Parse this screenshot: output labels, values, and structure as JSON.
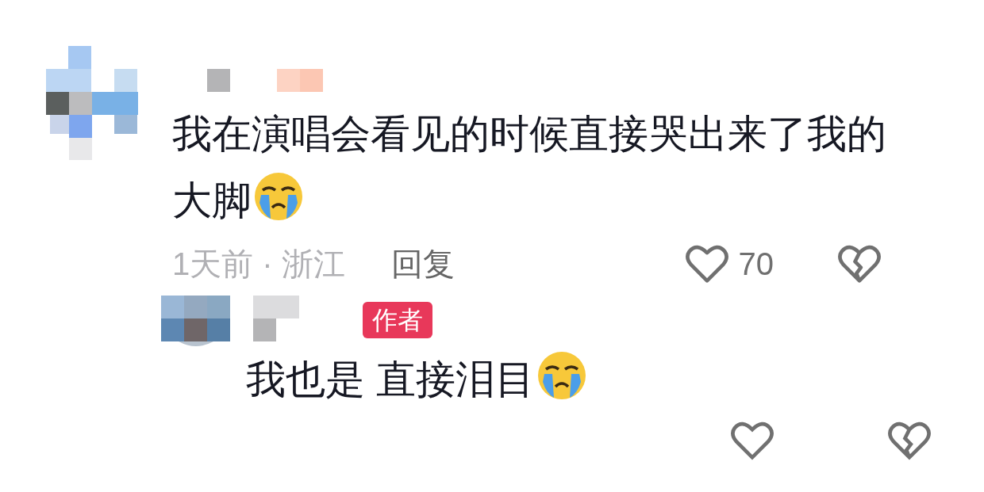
{
  "comment": {
    "text": "我在演唱会看见的时候直接哭出来了我的大脚",
    "meta": "1天前 · 浙江",
    "reply_label": "回复",
    "likes": "70",
    "liked": false,
    "reply": {
      "badge": "作者",
      "text": "我也是 直接泪目"
    }
  }
}
